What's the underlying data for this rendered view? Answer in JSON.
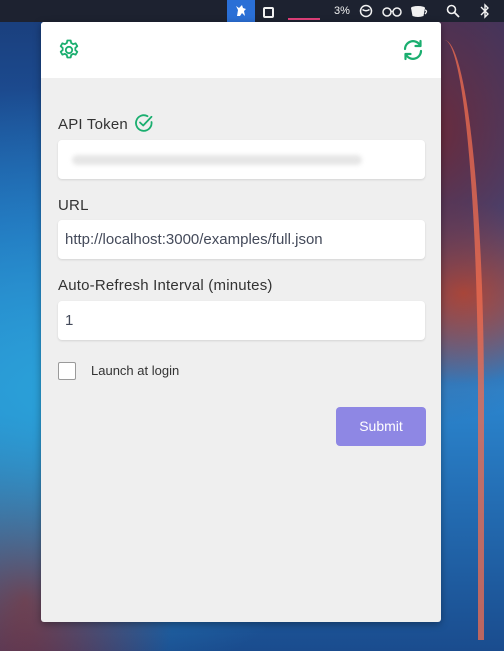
{
  "menubar": {
    "app_icon": "cat-icon",
    "window_icon": "square-icon",
    "battery_text": "3%",
    "icons": [
      "cat-icon",
      "square-icon",
      "circle-slash-icon",
      "glasses-icon",
      "cup-icon",
      "search-icon",
      "bluetooth-icon"
    ]
  },
  "header": {
    "left_icon": "gear-icon",
    "right_icon": "refresh-icon"
  },
  "form": {
    "token_label": "API Token",
    "token_status_icon": "check-circle-icon",
    "url_label": "URL",
    "url_value": "http://localhost:3000/examples/full.json",
    "interval_label": "Auto-Refresh Interval (minutes)",
    "interval_value": "1",
    "launch_label": "Launch at login",
    "launch_checked": false,
    "submit_label": "Submit"
  },
  "colors": {
    "accent": "#1aae6f",
    "submit": "#8e87e4",
    "panel_bg": "#efefef",
    "menubar_bg": "#1d2230",
    "active_app": "#2a6fd6"
  }
}
